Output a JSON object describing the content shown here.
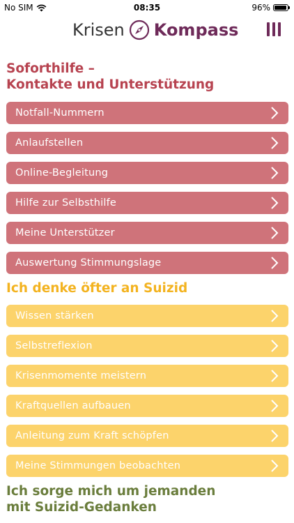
{
  "status": {
    "carrier": "No SIM",
    "time": "08:35",
    "battery": "96%",
    "battery_level": 0.96
  },
  "header": {
    "logo_part1": "Krisen",
    "logo_part2": "Kompass"
  },
  "colors": {
    "red": "#cf737a",
    "red_title": "#b74350",
    "yellow": "#fcd36b",
    "yellow_title": "#f3b320",
    "green_title": "#6a7d3c",
    "brand": "#6e2a59"
  },
  "sections": [
    {
      "title_line1": "Soforthilfe –",
      "title_line2": "Kontakte und Unterstützung",
      "items": [
        "Notfall-Nummern",
        "Anlaufstellen",
        "Online-Begleitung",
        "Hilfe zur Selbsthilfe",
        "Meine Unterstützer",
        "Auswertung Stimmungslage"
      ]
    },
    {
      "title_line1": "Ich denke öfter an Suizid",
      "items": [
        "Wissen stärken",
        "Selbstreflexion",
        "Krisenmomente meistern",
        "Kraftquellen aufbauen",
        "Anleitung zum Kraft schöpfen",
        "Meine Stimmungen beobachten"
      ]
    },
    {
      "title_line1": "Ich sorge mich um jemanden",
      "title_line2": "mit Suizid-Gedanken"
    }
  ]
}
